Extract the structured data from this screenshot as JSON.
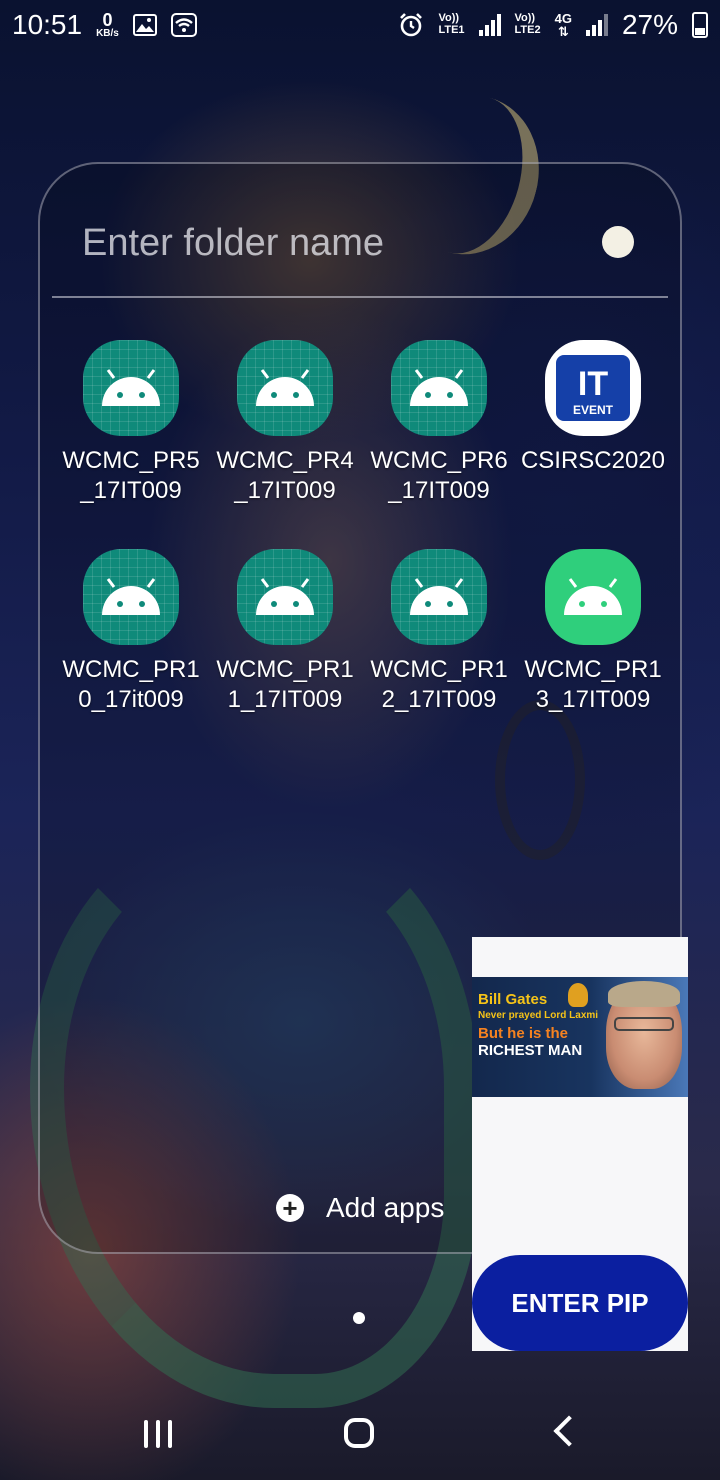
{
  "status_bar": {
    "time": "10:51",
    "net_speed_value": "0",
    "net_speed_unit": "KB/s",
    "sim1_label_top": "Vo))",
    "sim1_label_bottom": "LTE1",
    "sim2_label_top": "Vo))",
    "sim2_label_bottom": "LTE2",
    "network_type": "4G",
    "battery_percent": "27%"
  },
  "folder": {
    "name_placeholder": "Enter folder name",
    "apps": [
      {
        "label": "WCMC_PR5\n_17IT009",
        "icon": "android-icon"
      },
      {
        "label": "WCMC_PR4\n_17IT009",
        "icon": "android-icon"
      },
      {
        "label": "WCMC_PR6\n_17IT009",
        "icon": "android-icon"
      },
      {
        "label": "CSIRSC2020",
        "icon": "it-event-icon",
        "icon_text": "IT",
        "icon_subtext": "EVENT"
      },
      {
        "label": "WCMC_PR1\n0_17it009",
        "icon": "android-icon"
      },
      {
        "label": "WCMC_PR1\n1_17IT009",
        "icon": "android-icon"
      },
      {
        "label": "WCMC_PR1\n2_17IT009",
        "icon": "android-icon"
      },
      {
        "label": "WCMC_PR1\n3_17IT009",
        "icon": "android-icon"
      }
    ],
    "add_apps_label": "Add apps"
  },
  "pip": {
    "ad_line1": "Bill Gates",
    "ad_line2": "Never prayed Lord Laxmi",
    "ad_line3": "But he is the",
    "ad_line4": "RICHEST MAN",
    "button_label": "ENTER PIP",
    "button_color": "#0b1fa0"
  },
  "colors": {
    "android_icon": "#0f8a7a",
    "android_icon_light": "#2fcf7c",
    "it_event_blue": "#1540a8"
  }
}
